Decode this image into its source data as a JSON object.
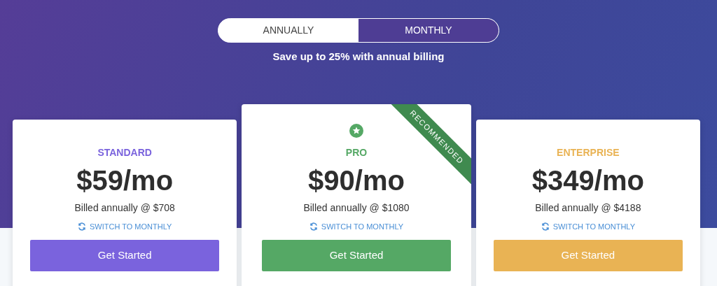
{
  "billing_toggle": [
    {
      "label": "ANNUALLY",
      "selected": false
    },
    {
      "label": "MONTHLY",
      "selected": true
    }
  ],
  "savings_note": "Save up to 25% with annual billing",
  "plans": [
    {
      "name": "STANDARD",
      "color": "#7a63dd",
      "featured": false,
      "price": "$59/mo",
      "billed": "Billed annually @ $708",
      "switch_link": "SWITCH TO MONTHLY",
      "button": "Get Started"
    },
    {
      "name": "PRO",
      "color": "#55a865",
      "featured": true,
      "ribbon": "RECOMMENDED",
      "price": "$90/mo",
      "billed": "Billed annually @ $1080",
      "switch_link": "SWITCH TO MONTHLY",
      "button": "Get Started"
    },
    {
      "name": "ENTERPRISE",
      "color": "#e9b354",
      "featured": false,
      "price": "$349/mo",
      "billed": "Billed annually @ $4188",
      "switch_link": "SWITCH TO MONTHLY",
      "button": "Get Started"
    }
  ]
}
